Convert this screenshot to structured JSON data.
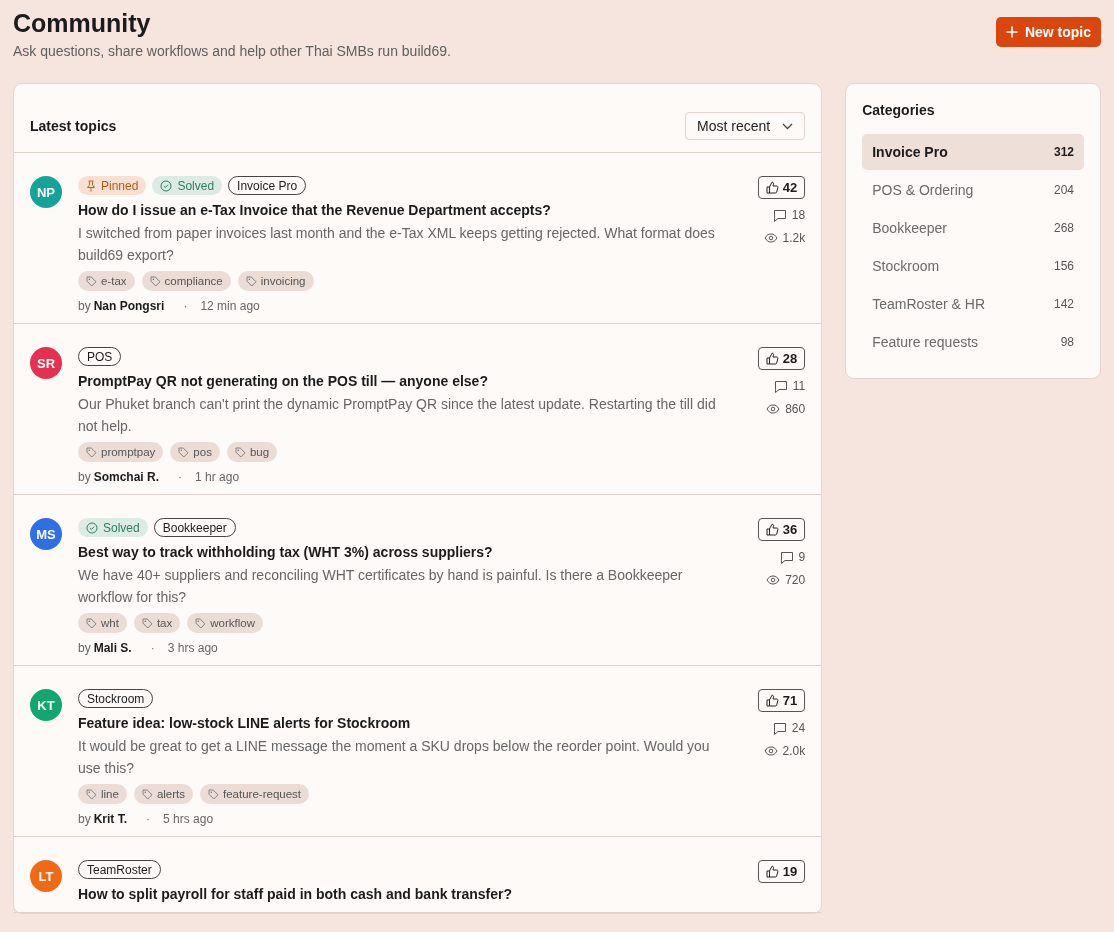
{
  "header": {
    "title": "Community",
    "subtitle": "Ask questions, share workflows and help other Thai SMBs run build69.",
    "new_topic_button": "New topic"
  },
  "topics_panel": {
    "title": "Latest topics",
    "sort": "Most recent",
    "topics": [
      {
        "initials": "NP",
        "color": "#14a39a",
        "badges": [
          {
            "kind": "pinned",
            "label": "Pinned"
          },
          {
            "kind": "solved",
            "label": "Solved"
          },
          {
            "kind": "category",
            "label": "Invoice Pro"
          }
        ],
        "title": "How do I issue an e-Tax Invoice that the Revenue Department accepts?",
        "excerpt": "I switched from paper invoices last month and the e-Tax XML keeps getting rejected. What format does build69 export?",
        "tags": [
          "e-tax",
          "compliance",
          "invoicing"
        ],
        "by": "by",
        "author": "Nan Pongsri",
        "separator": "·",
        "time": "12 min ago",
        "votes": "42",
        "comments": "18",
        "views": "1.2k"
      },
      {
        "initials": "SR",
        "color": "#e5304f",
        "badges": [
          {
            "kind": "category",
            "label": "POS"
          }
        ],
        "title": "PromptPay QR not generating on the POS till — anyone else?",
        "excerpt": "Our Phuket branch can't print the dynamic PromptPay QR since the latest update. Restarting the till did not help.",
        "tags": [
          "promptpay",
          "pos",
          "bug"
        ],
        "by": "by",
        "author": "Somchai R.",
        "separator": "·",
        "time": "1 hr ago",
        "votes": "28",
        "comments": "11",
        "views": "860"
      },
      {
        "initials": "MS",
        "color": "#2f6fe4",
        "badges": [
          {
            "kind": "solved",
            "label": "Solved"
          },
          {
            "kind": "category",
            "label": "Bookkeeper"
          }
        ],
        "title": "Best way to track withholding tax (WHT 3%) across suppliers?",
        "excerpt": "We have 40+ suppliers and reconciling WHT certificates by hand is painful. Is there a Bookkeeper workflow for this?",
        "tags": [
          "wht",
          "tax",
          "workflow"
        ],
        "by": "by",
        "author": "Mali S.",
        "separator": "·",
        "time": "3 hrs ago",
        "votes": "36",
        "comments": "9",
        "views": "720"
      },
      {
        "initials": "KT",
        "color": "#12a76f",
        "badges": [
          {
            "kind": "category",
            "label": "Stockroom"
          }
        ],
        "title": "Feature idea: low-stock LINE alerts for Stockroom",
        "excerpt": "It would be great to get a LINE message the moment a SKU drops below the reorder point. Would you use this?",
        "tags": [
          "line",
          "alerts",
          "feature-request"
        ],
        "by": "by",
        "author": "Krit T.",
        "separator": "·",
        "time": "5 hrs ago",
        "votes": "71",
        "comments": "24",
        "views": "2.0k"
      },
      {
        "initials": "LT",
        "color": "#f06a16",
        "badges": [
          {
            "kind": "category",
            "label": "TeamRoster"
          }
        ],
        "title": "How to split payroll for staff paid in both cash and bank transfer?",
        "votes": "19"
      }
    ]
  },
  "categories": {
    "title": "Categories",
    "items": [
      {
        "name": "Invoice Pro",
        "count": "312",
        "selected": true
      },
      {
        "name": "POS & Ordering",
        "count": "204",
        "selected": false
      },
      {
        "name": "Bookkeeper",
        "count": "268",
        "selected": false
      },
      {
        "name": "Stockroom",
        "count": "156",
        "selected": false
      },
      {
        "name": "TeamRoster & HR",
        "count": "142",
        "selected": false
      },
      {
        "name": "Feature requests",
        "count": "98",
        "selected": false
      }
    ]
  }
}
